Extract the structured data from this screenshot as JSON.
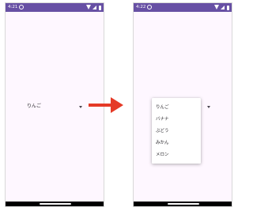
{
  "left_phone": {
    "status_time": "4:21",
    "spinner_selected": "りんご"
  },
  "right_phone": {
    "status_time": "4:22",
    "dropdown_items": [
      "りんご",
      "バナナ",
      "ぶどう",
      "みかん",
      "メロン"
    ]
  },
  "colors": {
    "status_bar": "#6750a4",
    "screen_background": "#fef7ff",
    "arrow": "#e53a27"
  }
}
